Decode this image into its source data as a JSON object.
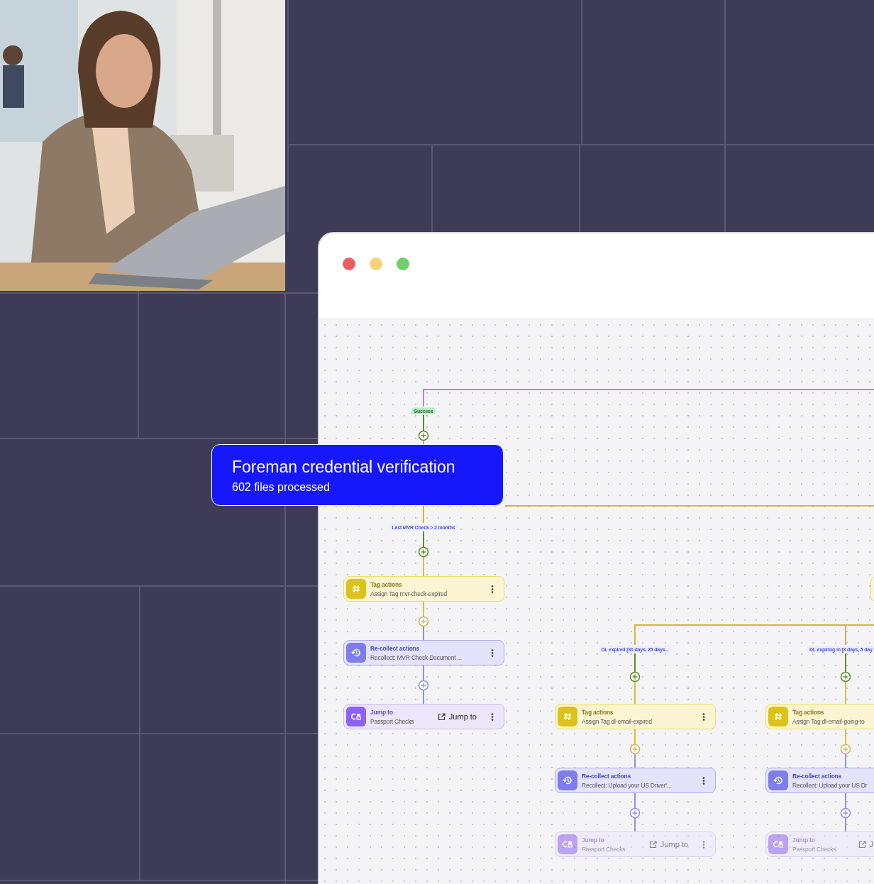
{
  "browser_window": {
    "controls": [
      {
        "color": "#ec5f5f"
      },
      {
        "color": "#f8d27a"
      },
      {
        "color": "#6fcf6a"
      }
    ]
  },
  "highlight_card": {
    "title": "Foreman credential verification",
    "subtitle": "602 files processed"
  },
  "flow": {
    "edge_labels": [
      {
        "kind": "success",
        "text": "Success"
      },
      {
        "kind": "condition",
        "text": "Last MVR Check > 2 months"
      },
      {
        "kind": "condition",
        "text": "DL expired [30 days, 25 days..."
      },
      {
        "kind": "condition",
        "text": "DL expiring in [3 days, 5 day"
      }
    ],
    "branches": [
      {
        "nodes": [
          {
            "kind": "tag",
            "title": "Tag actions",
            "detail": "Assign Tag mvr-check-expired",
            "faded": false
          },
          {
            "kind": "recollect",
            "title": "Re-collect actions",
            "detail": "Recollect: MVR Check Document ...",
            "faded": false
          },
          {
            "kind": "jump",
            "title": "Jump to",
            "detail": "Passport Checks",
            "link": "Jump to",
            "faded": false
          }
        ]
      },
      {
        "nodes": [
          {
            "kind": "tag",
            "title": "Tag actions",
            "detail": "Assign Tag dl-email-expired",
            "faded": false
          },
          {
            "kind": "recollect",
            "title": "Re-collect actions",
            "detail": "Recollect: Upload your US Driver'...",
            "faded": false
          },
          {
            "kind": "jump",
            "title": "Jump to",
            "detail": "Passport Checks",
            "link": "Jump to",
            "faded": true
          }
        ]
      },
      {
        "nodes": [
          {
            "kind": "tag",
            "title": "Tag actions",
            "detail": "Assign Tag dl-email-going-to",
            "faded": false
          },
          {
            "kind": "recollect",
            "title": "Re-collect actions",
            "detail": "Recollect: Upload your US Dr",
            "faded": false
          },
          {
            "kind": "jump",
            "title": "Jump to",
            "detail": "Passport Checks",
            "link": "J",
            "faded": true
          }
        ]
      }
    ]
  }
}
